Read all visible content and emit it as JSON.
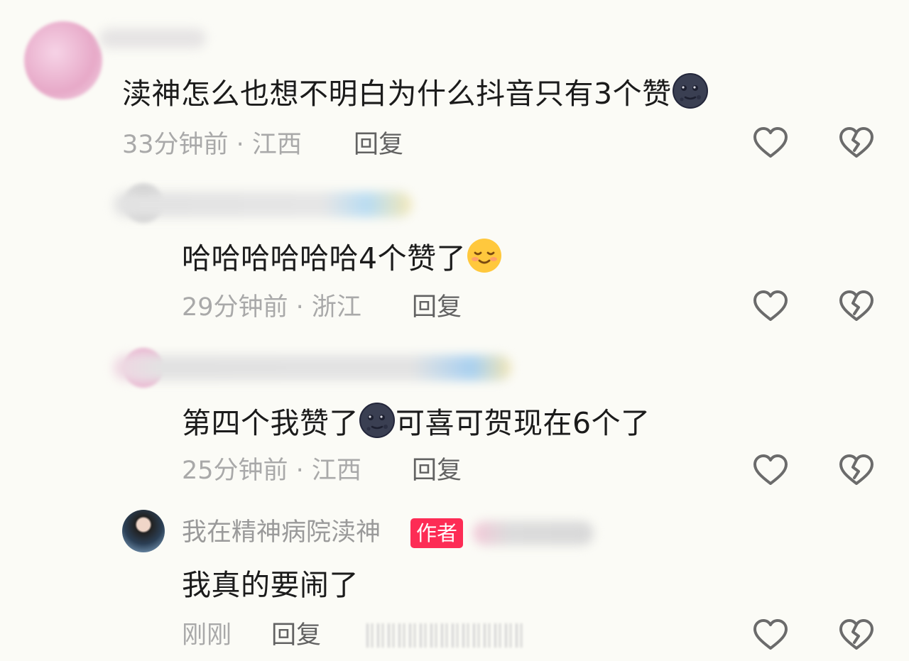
{
  "comments": [
    {
      "text": "渎神怎么也想不明白为什么抖音只有3个赞",
      "emoji": "new-moon-face-emoji",
      "meta": "33分钟前 · 江西",
      "reply": "回复"
    },
    {
      "text": "哈哈哈哈哈哈4个赞了",
      "emoji": "smiling-face-emoji",
      "meta": "29分钟前 · 浙江",
      "reply": "回复"
    },
    {
      "text_before": "第四个我赞了",
      "emoji": "new-moon-face-emoji",
      "text_after": "可喜可贺现在6个了",
      "meta": "25分钟前 · 江西",
      "reply": "回复"
    },
    {
      "username": "我在精神病院渎神",
      "badge": "作者",
      "text": "我真的要闹了",
      "meta": "刚刚",
      "reply": "回复"
    }
  ],
  "icons": {
    "like": "heart-outline-icon",
    "dislike": "broken-heart-icon"
  },
  "colors": {
    "badge": "#fd2c55",
    "meta": "#a9a9a9",
    "reply": "#626262",
    "background": "#fbfbf6"
  }
}
